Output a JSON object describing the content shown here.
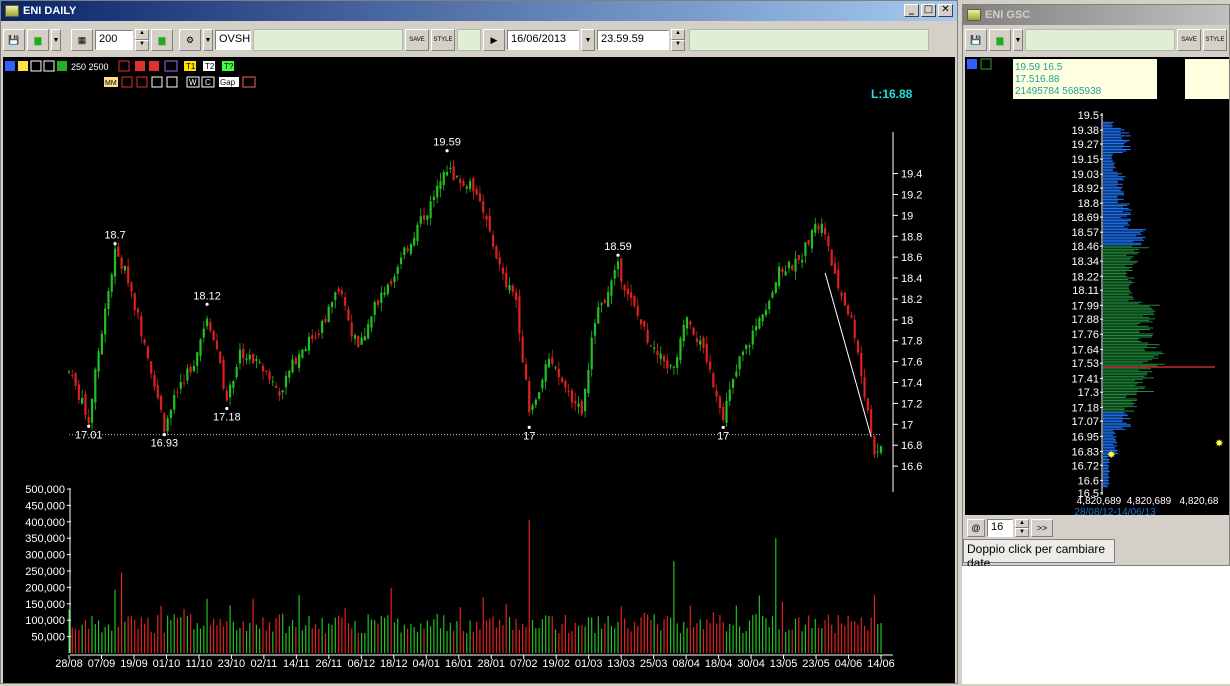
{
  "left_window": {
    "title": "ENI DAILY",
    "period": "200",
    "symbol": "OVSH",
    "date": "16/06/2013",
    "time": "23.59.59",
    "save_label": "SAVE",
    "style_label": "STYLE",
    "indicator_values": "250 2500",
    "last_price": "L:16.88",
    "tool_labels": [
      "MM",
      "T1",
      "T2",
      "T?",
      "W",
      "C",
      "Gap"
    ]
  },
  "right_window": {
    "title": "ENI GSC",
    "save_label": "SAVE",
    "style_label": "STYLE",
    "info_lines": [
      "19.59 16.5",
      "17.516.88",
      "21495784 5685938"
    ],
    "bottom_value": "16",
    "next_label": ">>",
    "at_label": "@",
    "date_range": "28/08/12-14/06/13",
    "vol_ticks": [
      "4,820,689",
      "4,820,689",
      "4,820,68"
    ],
    "status_text": "Doppio click per cambiare date"
  },
  "chart_data": {
    "type": "candlestick",
    "y_ticks": [
      "19.4",
      "19.2",
      "19",
      "18.8",
      "18.6",
      "18.4",
      "18.2",
      "18",
      "17.8",
      "17.6",
      "17.4",
      "17.2",
      "17",
      "16.8",
      "16.6"
    ],
    "x_ticks": [
      "28/08",
      "07/09",
      "19/09",
      "01/10",
      "11/10",
      "23/10",
      "02/11",
      "14/11",
      "26/11",
      "06/12",
      "18/12",
      "04/01",
      "16/01",
      "28/01",
      "07/02",
      "19/02",
      "01/03",
      "13/03",
      "25/03",
      "08/04",
      "18/04",
      "30/04",
      "13/05",
      "23/05",
      "04/06",
      "14/06"
    ],
    "annotations": [
      {
        "label": "17.01",
        "value": 17.01,
        "idx": 6
      },
      {
        "label": "18.7",
        "value": 18.7,
        "idx": 14
      },
      {
        "label": "16.93",
        "value": 16.93,
        "idx": 29
      },
      {
        "label": "18.12",
        "value": 18.12,
        "idx": 42
      },
      {
        "label": "17.18",
        "value": 17.18,
        "idx": 48
      },
      {
        "label": "19.59",
        "value": 19.59,
        "idx": 115
      },
      {
        "label": "17",
        "value": 17.0,
        "idx": 140
      },
      {
        "label": "18.59",
        "value": 18.59,
        "idx": 167
      },
      {
        "label": "17",
        "value": 17.0,
        "idx": 199
      }
    ],
    "reference_line": 16.9,
    "trendline": [
      {
        "idx": 230,
        "value": 18.45
      },
      {
        "idx": 244,
        "value": 16.88
      }
    ],
    "volume_ticks": [
      "500,000",
      "450,000",
      "400,000",
      "350,000",
      "300,000",
      "250,000",
      "200,000",
      "150,000",
      "100,000",
      "50,000"
    ],
    "price_range": [
      16.4,
      19.75
    ],
    "volume_range": [
      0,
      500000
    ],
    "profile_ticks": [
      "19.5",
      "19.38",
      "19.27",
      "19.15",
      "19.03",
      "18.92",
      "18.8",
      "18.69",
      "18.57",
      "18.46",
      "18.34",
      "18.22",
      "18.11",
      "17.99",
      "17.88",
      "17.76",
      "17.64",
      "17.53",
      "17.41",
      "17.3",
      "17.18",
      "17.07",
      "16.95",
      "16.83",
      "16.72",
      "16.6",
      "16.5"
    ],
    "colors": {
      "up": "#22c022",
      "down": "#e02020",
      "profile_high": "#1e78ff",
      "profile_mid": "#1f8a3a",
      "poc": "#c03030"
    }
  }
}
